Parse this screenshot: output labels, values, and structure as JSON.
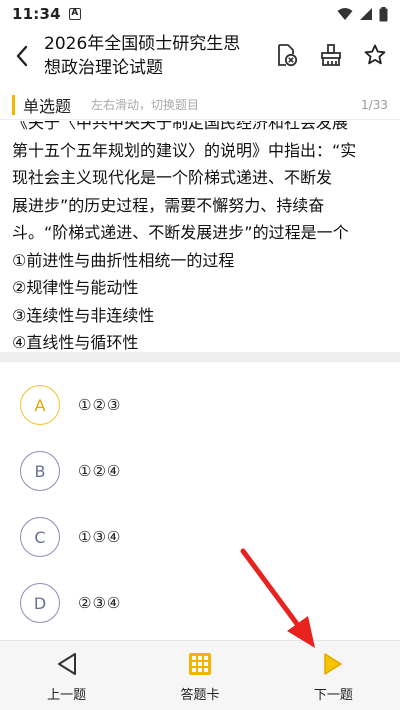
{
  "status": {
    "time": "11:34",
    "notification_letter": "A"
  },
  "header": {
    "title_line1": "2026年全国硕士研究生思",
    "title_line2": "想政治理论试题"
  },
  "question_type": {
    "label": "单选题",
    "hint": "左右滑动，切换题目",
    "counter": "1/33"
  },
  "question": {
    "lines": [
      "《关于〈中共中央关于制定国民经济和社会发展",
      "第十五个五年规划的建议〉的说明》中指出：“实",
      "现社会主义现代化是一个阶梯式递进、不断发",
      "展进步”的历史过程，需要不懈努力、持续奋",
      "斗。“阶梯式递进、不断发展进步”的过程是一个",
      "①前进性与曲折性相统一的过程",
      "②规律性与能动性",
      "③连续性与非连续性",
      "④直线性与循环性"
    ]
  },
  "options": [
    {
      "letter": "A",
      "text": "①②③",
      "selected": true
    },
    {
      "letter": "B",
      "text": "①②④",
      "selected": false
    },
    {
      "letter": "C",
      "text": "①③④",
      "selected": false
    },
    {
      "letter": "D",
      "text": "②③④",
      "selected": false
    }
  ],
  "bottom_nav": {
    "prev_label": "上一题",
    "card_label": "答题卡",
    "next_label": "下一题"
  },
  "colors": {
    "accent": "#f5b400",
    "option_border": "#8b8fb5",
    "arrow": "#e8231f"
  }
}
